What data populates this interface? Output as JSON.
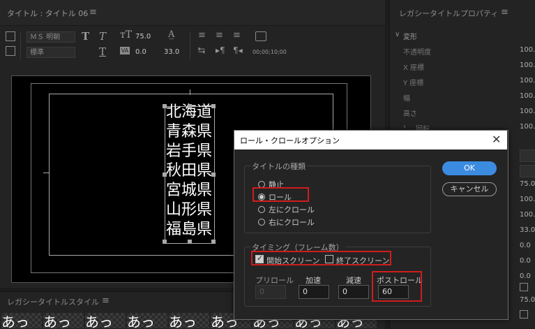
{
  "title_panel": {
    "tab_label": "タイトル : タイトル 06",
    "font_family": "ＭＳ 明朝",
    "font_style": "標準",
    "font_size": "75.0",
    "tracking": "0.0",
    "leading": "33.0",
    "timecode": "00;00;10;00",
    "vertical_text_lines": [
      "北海道",
      "青森県",
      "岩手県",
      "秋田県",
      "宮城県",
      "山形県",
      "福島県"
    ]
  },
  "style_panel": {
    "header": "レガシータイトルスタイル",
    "swatch_glyphs": [
      "あっ",
      "あっ",
      "あっ",
      "あっ",
      "あっ",
      "あっ",
      "あっ",
      "あっ",
      "あっ"
    ]
  },
  "properties_panel": {
    "header": "レガシータイトルプロパティ",
    "section": "変形",
    "rows": [
      {
        "label": "不透明度",
        "value": "100."
      },
      {
        "label": "X 座標",
        "value": "100."
      },
      {
        "label": "Y 座標",
        "value": "100."
      },
      {
        "label": "幅",
        "value": "100."
      },
      {
        "label": "高さ",
        "value": "100."
      },
      {
        "label": "回転",
        "value": "100."
      }
    ],
    "extra_values": [
      "75.0",
      "100.",
      "100.",
      "33.0",
      "0.0",
      "0.0",
      "0.0",
      "75.0"
    ]
  },
  "dialog": {
    "title": "ロール・クロールオプション",
    "type_group_label": "タイトルの種類",
    "type_options": [
      {
        "label": "静止",
        "selected": false
      },
      {
        "label": "ロール",
        "selected": true
      },
      {
        "label": "左にクロール",
        "selected": false
      },
      {
        "label": "右にクロール",
        "selected": false
      }
    ],
    "timing_group_label": "タイミング（フレーム数）",
    "start_screen_label": "開始スクリーン",
    "start_screen_checked": true,
    "end_screen_label": "終了スクリーン",
    "end_screen_checked": false,
    "preroll_label": "プリロール",
    "preroll_value": "0",
    "ease_in_label": "加速",
    "ease_in_value": "0",
    "ease_out_label": "減速",
    "ease_out_value": "0",
    "postroll_label": "ポストロール",
    "postroll_value": "60",
    "ok_label": "OK",
    "cancel_label": "キャンセル"
  },
  "colors": {
    "accent": "#3b8be0",
    "highlight": "#cf1d1d"
  }
}
